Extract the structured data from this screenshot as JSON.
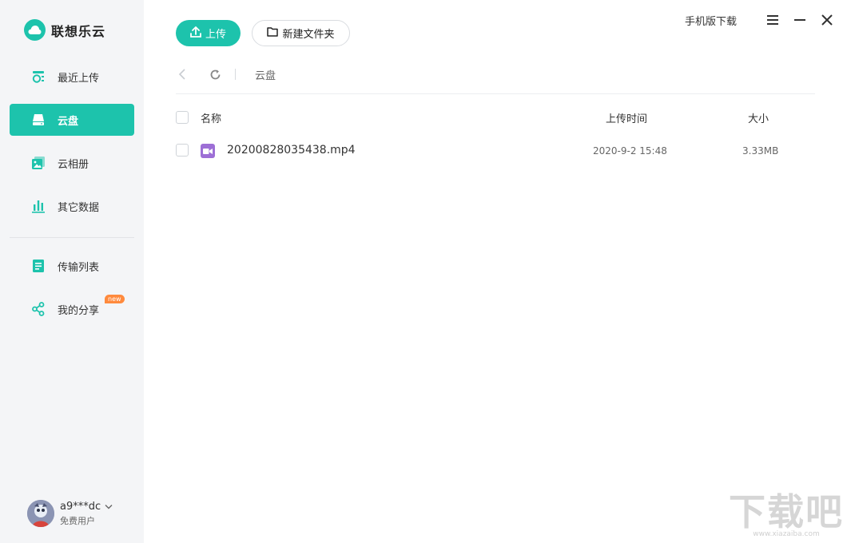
{
  "brand": {
    "name": "联想乐云",
    "color": "#1dc3ac"
  },
  "sidebar": {
    "items": [
      {
        "label": "最近上传",
        "icon": "recent-upload-icon"
      },
      {
        "label": "云盘",
        "icon": "drive-icon",
        "active": true
      },
      {
        "label": "云相册",
        "icon": "album-icon"
      },
      {
        "label": "其它数据",
        "icon": "chart-icon"
      },
      {
        "label": "传输列表",
        "icon": "transfer-list-icon"
      },
      {
        "label": "我的分享",
        "icon": "share-icon",
        "badge": "new"
      }
    ]
  },
  "user": {
    "name": "a9***dc",
    "tier": "免费用户"
  },
  "toolbar": {
    "upload_label": "上传",
    "new_folder_label": "新建文件夹"
  },
  "header": {
    "mobile_download": "手机版下载"
  },
  "breadcrumb": {
    "current": "云盘"
  },
  "table": {
    "columns": {
      "name": "名称",
      "time": "上传时间",
      "size": "大小"
    },
    "rows": [
      {
        "name": "20200828035438.mp4",
        "time": "2020-9-2 15:48",
        "size": "3.33MB",
        "type": "video"
      }
    ]
  },
  "watermark": {
    "text": "下载吧",
    "url": "www.xiazaiba.com"
  }
}
